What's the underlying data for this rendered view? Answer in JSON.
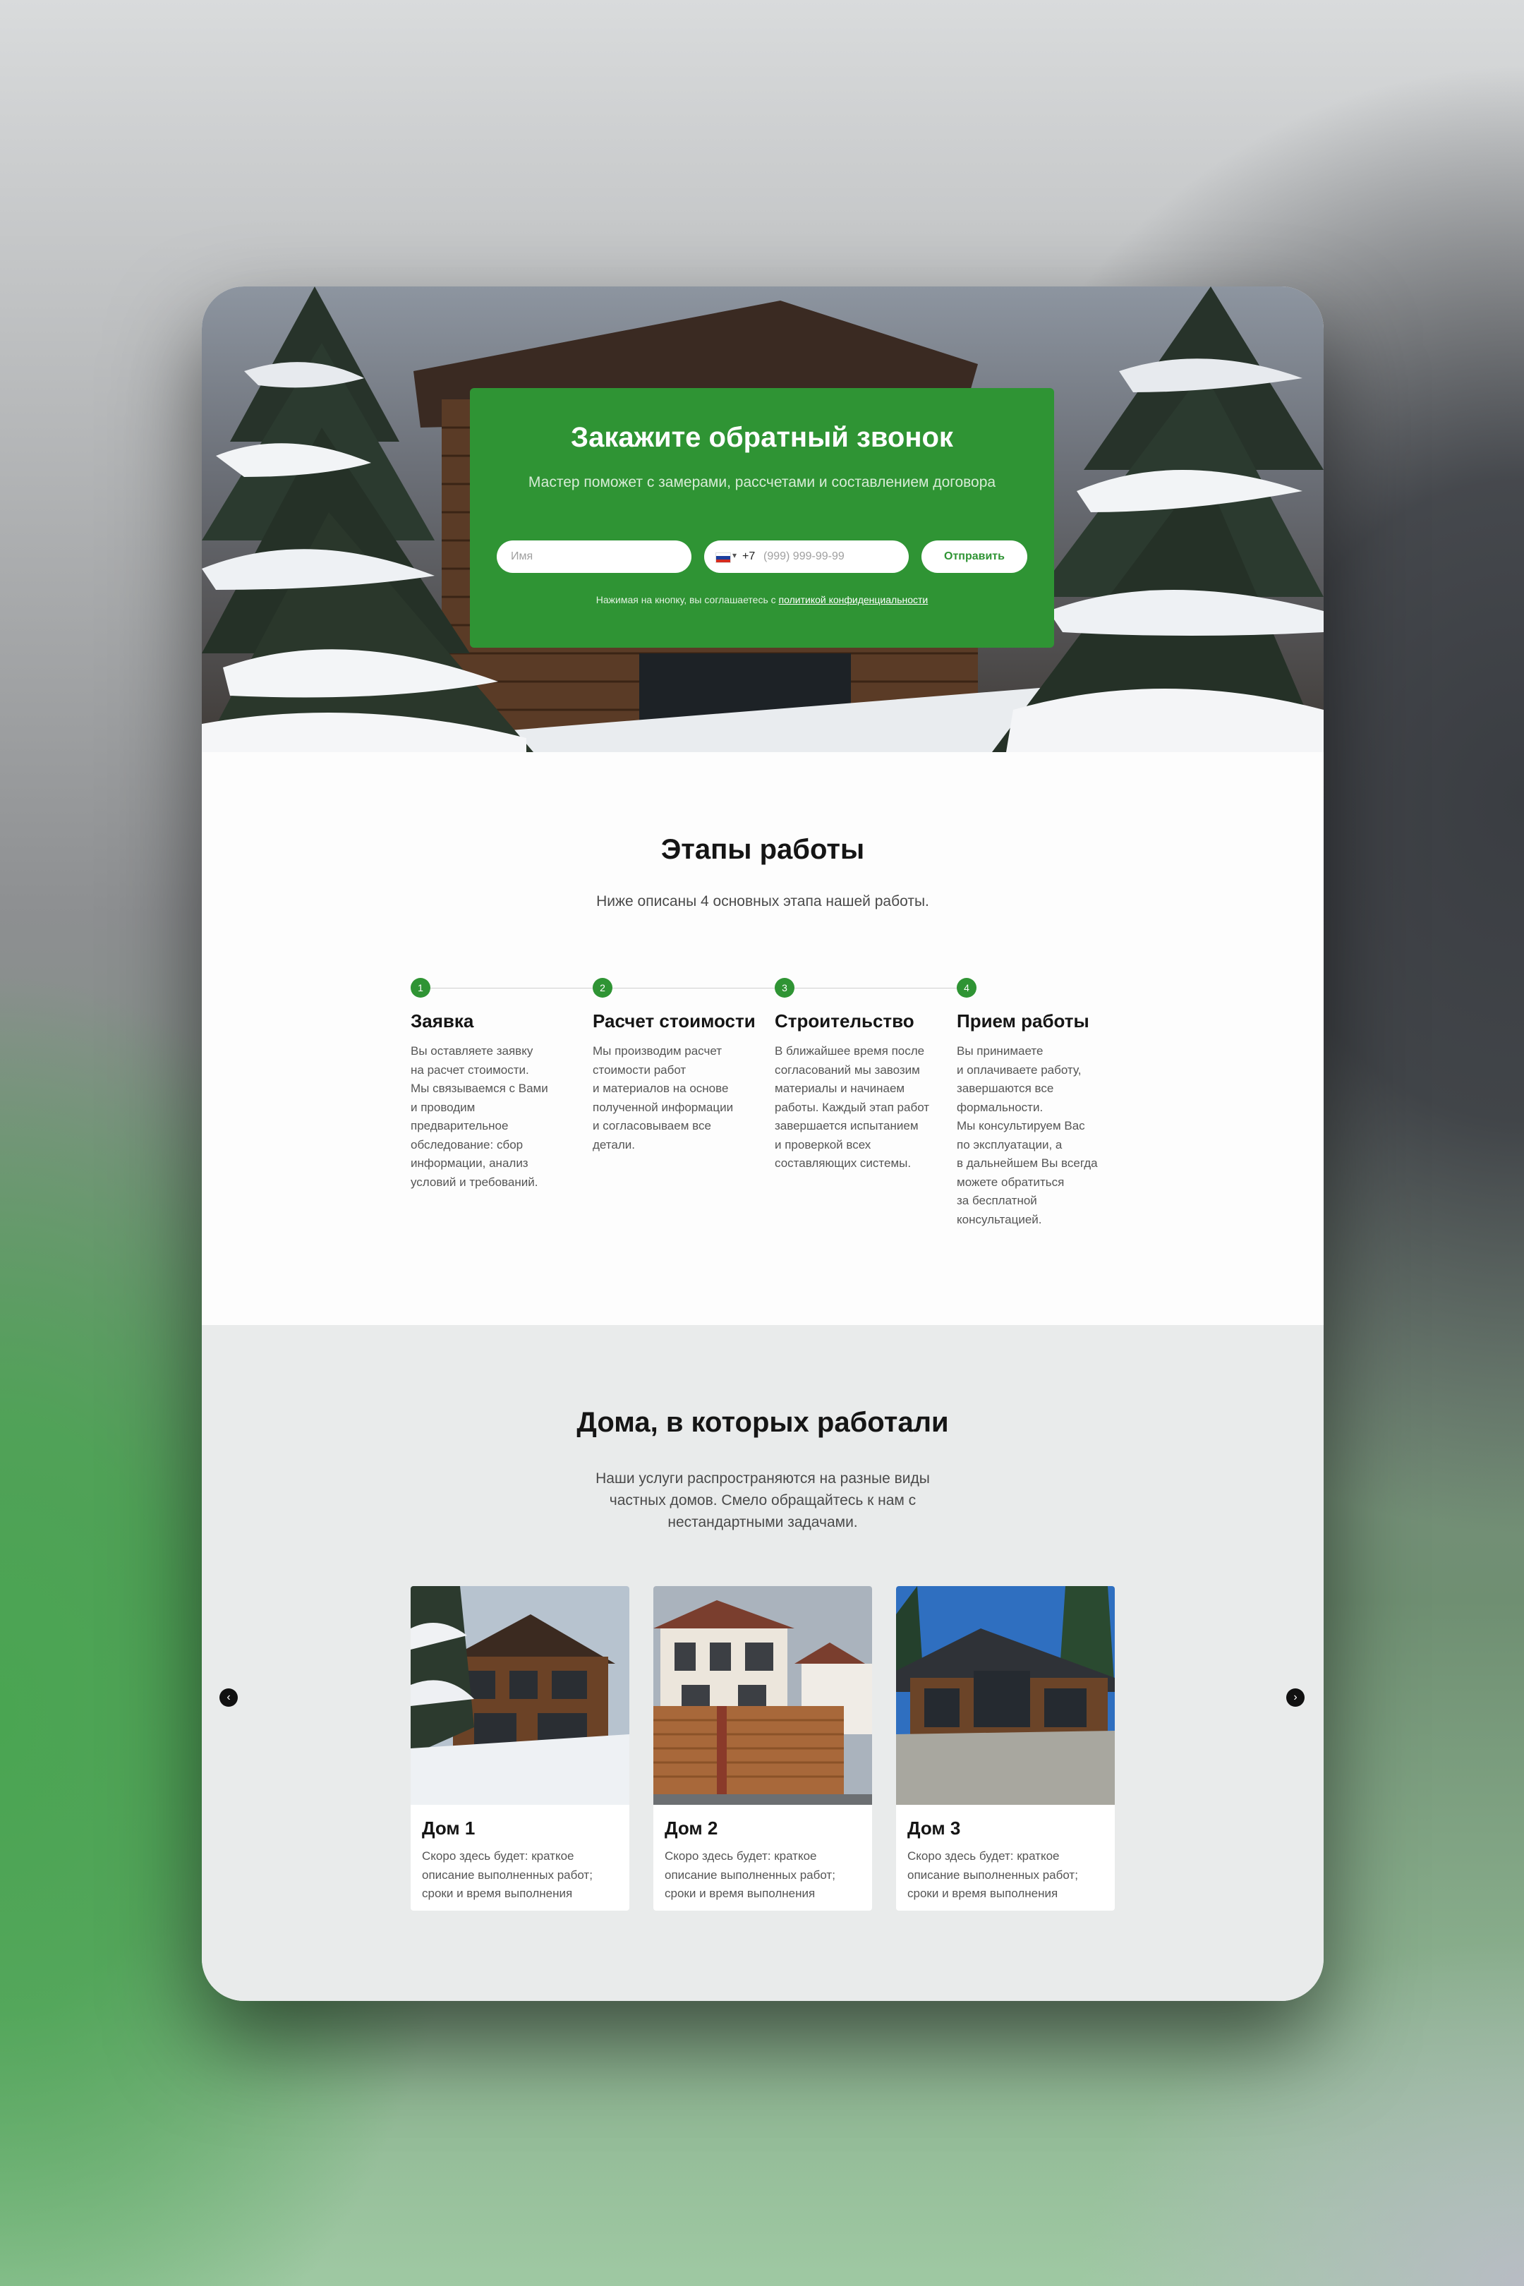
{
  "callback": {
    "title": "Закажите обратный звонок",
    "subtitle": "Мастер поможет с замерами, рассчетами и составлением договора",
    "name_placeholder": "Имя",
    "phone_code": "+7",
    "phone_placeholder": "(999) 999-99-99",
    "submit_label": "Отправить",
    "consent_text": "Нажимая на кнопку, вы соглашаетесь с ",
    "consent_link": "политикой конфиденциальности"
  },
  "stages": {
    "title": "Этапы работы",
    "lead": "Ниже описаны 4 основных этапа нашей работы.",
    "items": [
      {
        "num": "1",
        "title": "Заявка",
        "text": "Вы оставляете заявку\nна расчет стоимости.\nМы связываемся с Вами\nи проводим\nпредварительное\nобследование: сбор\nинформации, анализ\nусловий и требований."
      },
      {
        "num": "2",
        "title": "Расчет стоимости",
        "text": "Мы производим расчет\nстоимости работ\nи материалов на основе\nполученной информации\nи согласовываем все\nдетали."
      },
      {
        "num": "3",
        "title": "Строительство",
        "text": "В ближайшее время после\nсогласований мы завозим\nматериалы и начинаем\nработы. Каждый этап работ\nзавершается испытанием\nи проверкой всех\nсоставляющих системы."
      },
      {
        "num": "4",
        "title": "Прием работы",
        "text": "Вы принимаете\nи оплачиваете работу,\nзавершаются все\nформальности.\nМы консультируем Вас\nпо эксплуатации, а\nв дальнейшем Вы всегда\nможете обратиться\nза бесплатной\nконсультацией."
      }
    ]
  },
  "houses": {
    "title": "Дома, в которых работали",
    "lead_lines": [
      "Наши услуги распространяются на разные виды",
      "частных домов. Смело обращайтесь к нам с",
      "нестандартными задачами."
    ],
    "items": [
      {
        "title": "Дом 1",
        "text": "Скоро здесь будет: краткое описание выполненных работ; сроки и время выполнения"
      },
      {
        "title": "Дом 2",
        "text": "Скоро здесь будет: краткое описание выполненных работ; сроки и время выполнения"
      },
      {
        "title": "Дом 3",
        "text": "Скоро здесь будет: краткое описание выполненных работ; сроки и время выполнения"
      }
    ],
    "prev_icon": "chevron-left-icon",
    "next_icon": "chevron-right-icon"
  },
  "colors": {
    "accent": "#2f9434",
    "houses_bg": "#e9ebeb"
  }
}
